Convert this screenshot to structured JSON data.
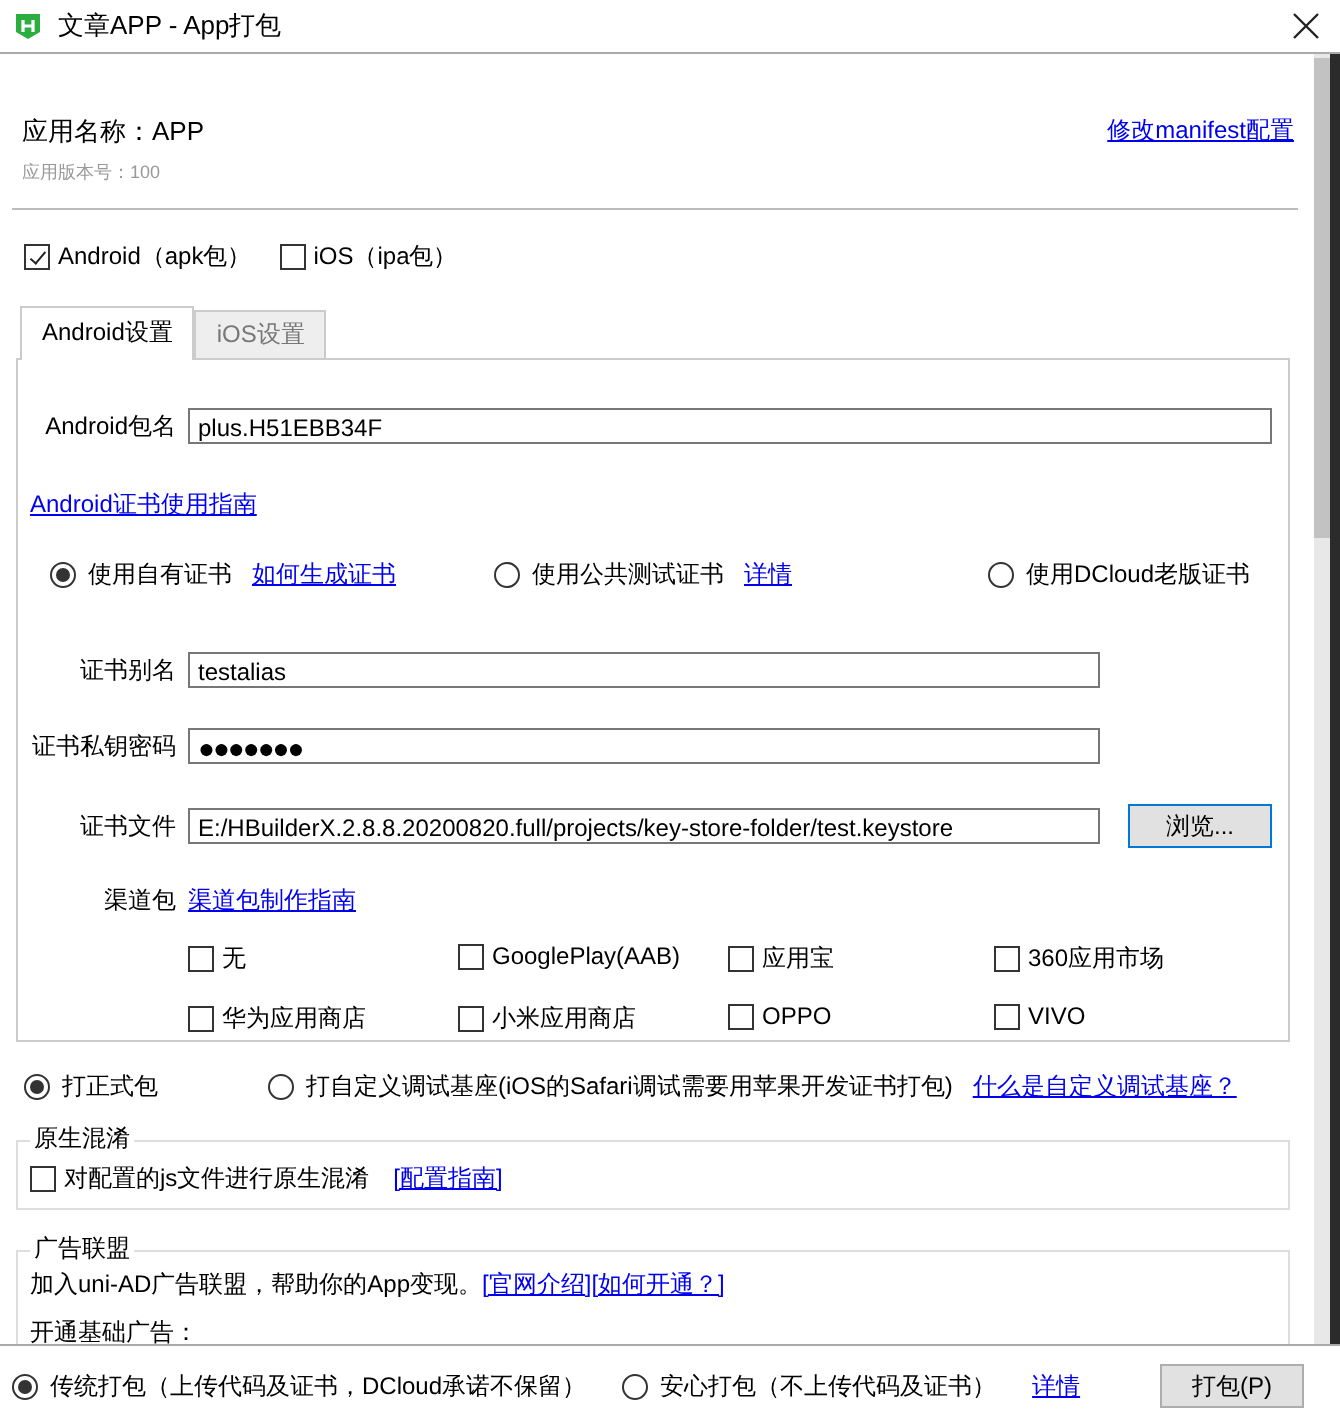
{
  "window": {
    "title": "文章APP - App打包"
  },
  "header": {
    "app_name": "应用名称：APP",
    "version": "应用版本号：100",
    "manifest_link": "修改manifest配置"
  },
  "platforms": [
    {
      "label": "Android（apk包）",
      "checked": true
    },
    {
      "label": "iOS（ipa包）",
      "checked": false
    }
  ],
  "tabs": [
    {
      "label": "Android设置",
      "selected": true
    },
    {
      "label": "iOS设置",
      "selected": false
    }
  ],
  "android": {
    "package_label": "Android包名",
    "package_value": "plus.H51EBB34F",
    "cert_guide_link": "Android证书使用指南",
    "cert_options": [
      {
        "label": "使用自有证书",
        "link": "如何生成证书",
        "selected": true
      },
      {
        "label": "使用公共测试证书",
        "link": "详情",
        "selected": false
      },
      {
        "label": "使用DCloud老版证书",
        "selected": false
      }
    ],
    "fields": [
      {
        "kind": "text",
        "label": "证书别名",
        "value": "testalias"
      },
      {
        "kind": "password",
        "label": "证书私钥密码",
        "value": "●●●●●●●"
      },
      {
        "kind": "file",
        "label": "证书文件",
        "value": "E:/HBuilderX.2.8.8.20200820.full/projects/key-store-folder/test.keystore",
        "button": "浏览..."
      }
    ],
    "channels": {
      "label": "渠道包",
      "link": "渠道包制作指南",
      "items": [
        {
          "label": "无",
          "checked": false
        },
        {
          "label": "GooglePlay(AAB)",
          "checked": false
        },
        {
          "label": "应用宝",
          "checked": false
        },
        {
          "label": "360应用市场",
          "checked": false
        },
        {
          "label": "华为应用商店",
          "checked": false
        },
        {
          "label": "小米应用商店",
          "checked": false
        },
        {
          "label": "OPPO",
          "checked": false
        },
        {
          "label": "VIVO",
          "checked": false
        }
      ]
    }
  },
  "build_type": {
    "options": [
      {
        "label": "打正式包",
        "selected": true
      },
      {
        "label": "打自定义调试基座(iOS的Safari调试需要用苹果开发证书打包)",
        "selected": false
      }
    ],
    "link": "什么是自定义调试基座？"
  },
  "obfuscation": {
    "title": "原生混淆",
    "option": {
      "label": "对配置的js文件进行原生混淆",
      "checked": false
    },
    "link": "[配置指南]"
  },
  "ads": {
    "title": "广告联盟",
    "text": "加入uni-AD广告联盟，帮助你的App变现。",
    "links": [
      "[官网介绍]",
      "[如何开通？]"
    ],
    "subtitle": "开通基础广告："
  },
  "footer": {
    "options": [
      {
        "label": "传统打包（上传代码及证书，DCloud承诺不保留）",
        "selected": true
      },
      {
        "label": "安心打包（不上传代码及证书）",
        "selected": false
      }
    ],
    "link": "详情",
    "button": "打包(P)"
  }
}
